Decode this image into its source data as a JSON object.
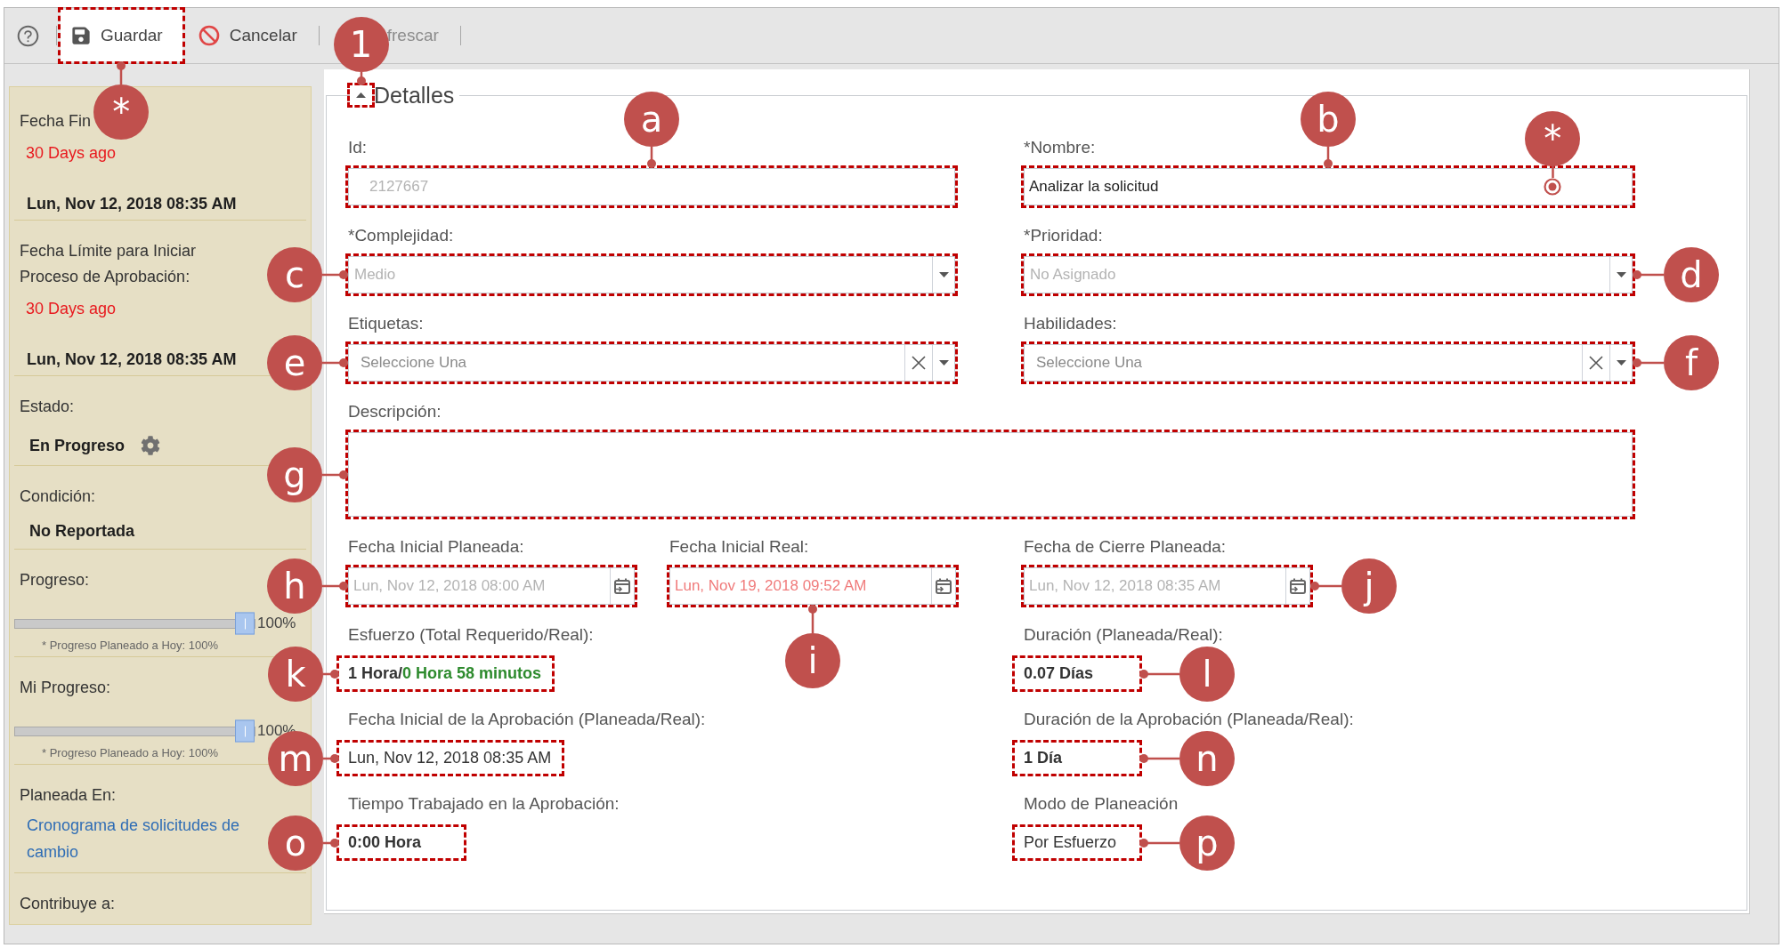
{
  "toolbar": {
    "buttons": [
      {
        "kind": "save",
        "label": "Guardar",
        "disabled": false,
        "highlighted": true,
        "callout": "*"
      },
      {
        "kind": "cancel",
        "label": "Cancelar",
        "disabled": false,
        "highlighted": false
      },
      {
        "kind": "text",
        "label": "frescar",
        "disabled": true,
        "highlighted": false
      }
    ]
  },
  "sidebar": {
    "sections": [
      {
        "label": "Fecha Fin",
        "values": [
          {
            "kind": "overdue",
            "text": "30 Days ago"
          },
          {
            "kind": "date",
            "text": "Lun, Nov 12, 2018 08:35 AM"
          }
        ]
      },
      {
        "label": "Fecha Límite para Iniciar Proceso de Aprobación:",
        "values": [
          {
            "kind": "overdue",
            "text": "30 Days ago"
          },
          {
            "kind": "date",
            "text": "Lun, Nov 12, 2018 08:35 AM"
          }
        ]
      },
      {
        "label": "Estado:",
        "values": [
          {
            "kind": "status",
            "text": "En Progreso"
          }
        ]
      },
      {
        "label": "Condición:",
        "values": [
          {
            "kind": "plain",
            "text": "No Reportada"
          }
        ]
      },
      {
        "label": "Progreso:",
        "values": [
          {
            "kind": "slider",
            "level": 1,
            "reading": "100%",
            "note": "* Progreso Planeado a Hoy: 100%"
          }
        ]
      },
      {
        "label": "Mi Progreso:",
        "values": [
          {
            "kind": "slider",
            "level": 1,
            "reading": "100%",
            "note": "* Progreso Planeado a Hoy: 100%"
          }
        ]
      },
      {
        "label": "Planeada En:",
        "values": [
          {
            "kind": "link",
            "text": "Cronograma de solicitudes de cambio"
          }
        ]
      },
      {
        "label": "Contribuye a:"
      }
    ]
  },
  "details": {
    "title": "Detalles",
    "expanded": true,
    "toggle_highlighted": true,
    "toggle_callout": "1",
    "rows": [
      [
        {
          "kind": "number",
          "label": "Id:",
          "value": "2127667",
          "disabled": true,
          "highlighted": true,
          "callout": "a"
        },
        {
          "kind": "text",
          "label": "*Nombre:",
          "value": "Analizar la solicitud",
          "disabled": false,
          "highlighted": true,
          "callout": "b",
          "marker": "*"
        }
      ],
      [
        {
          "kind": "select",
          "label": "*Complejidad:",
          "value": "Medio",
          "disabled": true,
          "highlighted": true,
          "callout": "c"
        },
        {
          "kind": "select",
          "label": "*Prioridad:",
          "value": "No Asignado",
          "disabled": true,
          "highlighted": true,
          "callout": "d"
        }
      ],
      [
        {
          "kind": "multiselect",
          "label": "Etiquetas:",
          "placeholder": "Seleccione Una",
          "disabled": false,
          "highlighted": true,
          "callout": "e"
        },
        {
          "kind": "multiselect",
          "label": "Habilidades:",
          "placeholder": "Seleccione Una",
          "disabled": false,
          "highlighted": true,
          "callout": "f"
        }
      ],
      [
        {
          "kind": "textarea",
          "label": "Descripción:",
          "disabled": false,
          "highlighted": true,
          "callout": "g"
        }
      ],
      [
        {
          "kind": "date",
          "label": "Fecha Inicial Planeada:",
          "value": "Lun, Nov 12, 2018 08:00 AM",
          "disabled": true,
          "overdue": false,
          "highlighted": true,
          "callout": "h"
        },
        {
          "kind": "date",
          "label": "Fecha Inicial Real:",
          "value": "Lun, Nov 19, 2018 09:52 AM",
          "disabled": true,
          "overdue": true,
          "highlighted": true,
          "callout": "i"
        },
        {
          "kind": "date",
          "label": "Fecha de Cierre Planeada:",
          "value": "Lun, Nov 12, 2018 08:35 AM",
          "disabled": true,
          "overdue": false,
          "highlighted": true,
          "callout": "j"
        }
      ],
      [
        {
          "kind": "readout",
          "label": "Esfuerzo (Total Requerido/Real):",
          "segments": [
            {
              "text": "1 Hora/",
              "color": "#333333"
            },
            {
              "text": "0 Hora 58 minutos",
              "color": "#2e8b2e"
            }
          ],
          "bold": true,
          "highlighted": true,
          "callout": "k"
        },
        {
          "kind": "readout",
          "label": "Duración (Planeada/Real):",
          "value": "0.07 Días",
          "bold": true,
          "highlighted": true,
          "callout": "l"
        }
      ],
      [
        {
          "kind": "readout",
          "label": "Fecha Inicial de la Aprobación (Planeada/Real):",
          "value": "Lun, Nov 12, 2018 08:35 AM",
          "bold": false,
          "highlighted": true,
          "callout": "m"
        },
        {
          "kind": "readout",
          "label": "Duración de la Aprobación (Planeada/Real):",
          "value": "1 Día",
          "bold": true,
          "highlighted": true,
          "callout": "n"
        }
      ],
      [
        {
          "kind": "readout",
          "label": "Tiempo Trabajado en la Aprobación:",
          "value": "0:00 Hora",
          "bold": true,
          "highlighted": true,
          "callout": "o"
        },
        {
          "kind": "readout",
          "label": "Modo de Planeación",
          "value": "Por Esfuerzo",
          "bold": false,
          "highlighted": true,
          "callout": "p"
        }
      ]
    ]
  }
}
